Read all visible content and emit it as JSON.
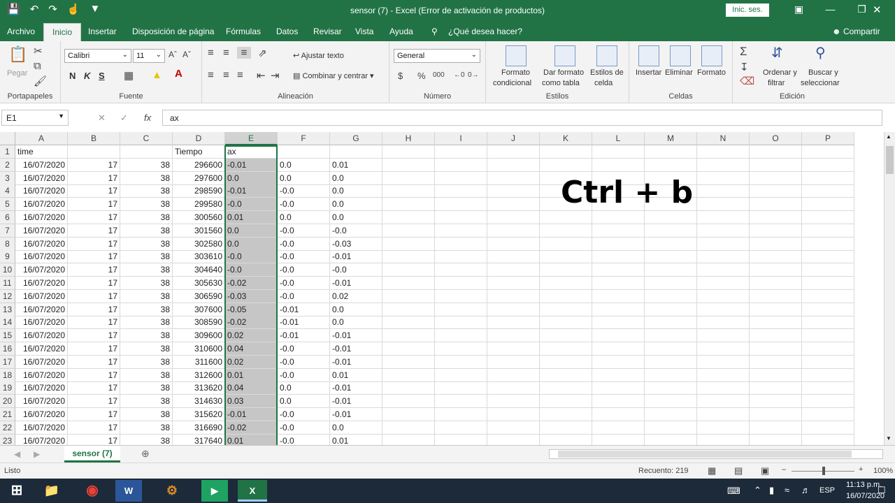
{
  "title": "sensor (7)  -  Excel (Error de activación de productos)",
  "signin": "Inic. ses.",
  "menu": [
    "Archivo",
    "Inicio",
    "Insertar",
    "Disposición de página",
    "Fórmulas",
    "Datos",
    "Revisar",
    "Vista",
    "Ayuda",
    "¿Qué desea hacer?"
  ],
  "share": "Compartir",
  "ribbon": {
    "paste": "Pegar",
    "portapapeles": "Portapapeles",
    "font_name": "Calibri",
    "font_size": "11",
    "fuente": "Fuente",
    "bold": "N",
    "italic": "K",
    "underline": "S",
    "wrap": "Ajustar texto",
    "merge": "Combinar y centrar",
    "alineacion": "Alineación",
    "number_format": "General",
    "numero": "Número",
    "cond_format_1": "Formato",
    "cond_format_2": "condicional",
    "table_format_1": "Dar formato",
    "table_format_2": "como tabla",
    "cell_styles_1": "Estilos de",
    "cell_styles_2": "celda",
    "estilos": "Estilos",
    "insert": "Insertar",
    "delete": "Eliminar",
    "format": "Formato",
    "celdas": "Celdas",
    "sort_1": "Ordenar y",
    "sort_2": "filtrar",
    "find_1": "Buscar y",
    "find_2": "seleccionar",
    "edicion": "Edición"
  },
  "formula": {
    "cell": "E1",
    "fx": "fx",
    "value": "ax"
  },
  "columns": [
    "A",
    "B",
    "C",
    "D",
    "E",
    "F",
    "G",
    "H",
    "I",
    "J",
    "K",
    "L",
    "M",
    "N",
    "O",
    "P"
  ],
  "rows": [
    [
      "1",
      "time",
      "",
      "",
      "Tiempo",
      "ax",
      "",
      ""
    ],
    [
      "2",
      "16/07/2020",
      "17",
      "38",
      "296600",
      "-0.01",
      "0.0",
      "0.01"
    ],
    [
      "3",
      "16/07/2020",
      "17",
      "38",
      "297600",
      "0.0",
      "0.0",
      "0.0"
    ],
    [
      "4",
      "16/07/2020",
      "17",
      "38",
      "298590",
      "-0.01",
      "-0.0",
      "0.0"
    ],
    [
      "5",
      "16/07/2020",
      "17",
      "38",
      "299580",
      "-0.0",
      "-0.0",
      "0.0"
    ],
    [
      "6",
      "16/07/2020",
      "17",
      "38",
      "300560",
      "0.01",
      "0.0",
      "0.0"
    ],
    [
      "7",
      "16/07/2020",
      "17",
      "38",
      "301560",
      "0.0",
      "-0.0",
      "-0.0"
    ],
    [
      "8",
      "16/07/2020",
      "17",
      "38",
      "302580",
      "0.0",
      "-0.0",
      "-0.03"
    ],
    [
      "9",
      "16/07/2020",
      "17",
      "38",
      "303610",
      "-0.0",
      "-0.0",
      "-0.01"
    ],
    [
      "10",
      "16/07/2020",
      "17",
      "38",
      "304640",
      "-0.0",
      "-0.0",
      "-0.0"
    ],
    [
      "11",
      "16/07/2020",
      "17",
      "38",
      "305630",
      "-0.02",
      "-0.0",
      "-0.01"
    ],
    [
      "12",
      "16/07/2020",
      "17",
      "38",
      "306590",
      "-0.03",
      "-0.0",
      "0.02"
    ],
    [
      "13",
      "16/07/2020",
      "17",
      "38",
      "307600",
      "-0.05",
      "-0.01",
      "0.0"
    ],
    [
      "14",
      "16/07/2020",
      "17",
      "38",
      "308590",
      "-0.02",
      "-0.01",
      "0.0"
    ],
    [
      "15",
      "16/07/2020",
      "17",
      "38",
      "309600",
      "0.02",
      "-0.01",
      "-0.01"
    ],
    [
      "16",
      "16/07/2020",
      "17",
      "38",
      "310600",
      "0.04",
      "-0.0",
      "-0.01"
    ],
    [
      "17",
      "16/07/2020",
      "17",
      "38",
      "311600",
      "0.02",
      "-0.0",
      "-0.01"
    ],
    [
      "18",
      "16/07/2020",
      "17",
      "38",
      "312600",
      "0.01",
      "-0.0",
      "0.01"
    ],
    [
      "19",
      "16/07/2020",
      "17",
      "38",
      "313620",
      "0.04",
      "0.0",
      "-0.01"
    ],
    [
      "20",
      "16/07/2020",
      "17",
      "38",
      "314630",
      "0.03",
      "0.0",
      "-0.01"
    ],
    [
      "21",
      "16/07/2020",
      "17",
      "38",
      "315620",
      "-0.01",
      "-0.0",
      "-0.01"
    ],
    [
      "22",
      "16/07/2020",
      "17",
      "38",
      "316690",
      "-0.02",
      "-0.0",
      "0.0"
    ],
    [
      "23",
      "16/07/2020",
      "17",
      "38",
      "317640",
      "0.01",
      "-0.0",
      "0.01"
    ]
  ],
  "overlay_text": "Ctrl + b",
  "sheet_tab": "sensor (7)",
  "status": {
    "ready": "Listo",
    "count": "Recuento: 219",
    "zoom": "100%"
  },
  "taskbar": {
    "lang": "ESP",
    "time": "11:13 p.m.",
    "date": "16/07/2020"
  },
  "colors": {
    "accent": "#217346",
    "taskbar": "#1c2a3a"
  }
}
